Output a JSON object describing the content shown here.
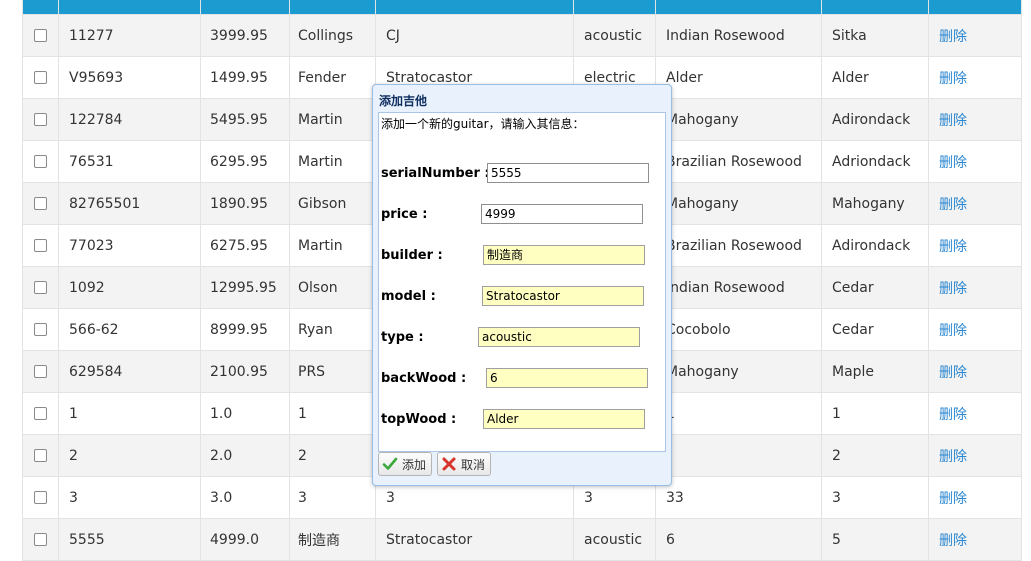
{
  "table": {
    "headers": [
      "",
      "",
      "",
      "",
      "",
      "",
      "",
      ""
    ],
    "rows": [
      {
        "serial": "11277",
        "price": "3999.95",
        "builder": "Collings",
        "model": "CJ",
        "type": "acoustic",
        "back": "Indian Rosewood",
        "top": "Sitka",
        "action": "删除"
      },
      {
        "serial": "V95693",
        "price": "1499.95",
        "builder": "Fender",
        "model": "Stratocastor",
        "type": "electric",
        "back": "Alder",
        "top": "Alder",
        "action": "删除"
      },
      {
        "serial": "122784",
        "price": "5495.95",
        "builder": "Martin",
        "model": "",
        "type": "",
        "back": "Mahogany",
        "top": "Adirondack",
        "action": "删除"
      },
      {
        "serial": "76531",
        "price": "6295.95",
        "builder": "Martin",
        "model": "",
        "type": "",
        "back": "Brazilian Rosewood",
        "top": "Adriondack",
        "action": "删除"
      },
      {
        "serial": "82765501",
        "price": "1890.95",
        "builder": "Gibson",
        "model": "",
        "type": "",
        "back": "Mahogany",
        "top": "Mahogany",
        "action": "删除"
      },
      {
        "serial": "77023",
        "price": "6275.95",
        "builder": "Martin",
        "model": "",
        "type": "",
        "back": "Brazilian Rosewood",
        "top": "Adirondack",
        "action": "删除"
      },
      {
        "serial": "1092",
        "price": "12995.95",
        "builder": "Olson",
        "model": "",
        "type": "",
        "back": "Indian Rosewood",
        "top": "Cedar",
        "action": "删除"
      },
      {
        "serial": "566-62",
        "price": "8999.95",
        "builder": "Ryan",
        "model": "",
        "type": "",
        "back": "Cocobolo",
        "top": "Cedar",
        "action": "删除"
      },
      {
        "serial": "629584",
        "price": "2100.95",
        "builder": "PRS",
        "model": "",
        "type": "",
        "back": "Mahogany",
        "top": "Maple",
        "action": "删除"
      },
      {
        "serial": "1",
        "price": "1.0",
        "builder": "1",
        "model": "",
        "type": "",
        "back": "1",
        "top": "1",
        "action": "删除"
      },
      {
        "serial": "2",
        "price": "2.0",
        "builder": "2",
        "model": "",
        "type": "",
        "back": "",
        "top": "2",
        "action": "删除"
      },
      {
        "serial": "3",
        "price": "3.0",
        "builder": "3",
        "model": "3",
        "type": "3",
        "back": "33",
        "top": "3",
        "action": "删除"
      },
      {
        "serial": "5555",
        "price": "4999.0",
        "builder": "制造商",
        "model": "Stratocastor",
        "type": "acoustic",
        "back": "6",
        "top": "5",
        "action": "删除"
      }
    ]
  },
  "dialog": {
    "title": "添加吉他",
    "intro": "添加一个新的guitar，请输入其信息：",
    "fields": {
      "serialNumber": {
        "label": "serialNumber :",
        "value": "5555"
      },
      "price": {
        "label": "price :",
        "value": "4999"
      },
      "builder": {
        "label": "builder :",
        "value": "制造商"
      },
      "model": {
        "label": "model :",
        "value": "Stratocastor"
      },
      "type": {
        "label": "type :",
        "value": "acoustic"
      },
      "backWood": {
        "label": "backWood :",
        "value": "6"
      },
      "topWood": {
        "label": "topWood :",
        "value": "Alder"
      }
    },
    "add_label": "添加",
    "cancel_label": "取消",
    "icons": {
      "add": "check-icon",
      "cancel": "cancel-x-icon"
    },
    "colors": {
      "header": "#1b9bd0",
      "input_bg": "#ffffc2",
      "link": "#2a86d0"
    }
  }
}
